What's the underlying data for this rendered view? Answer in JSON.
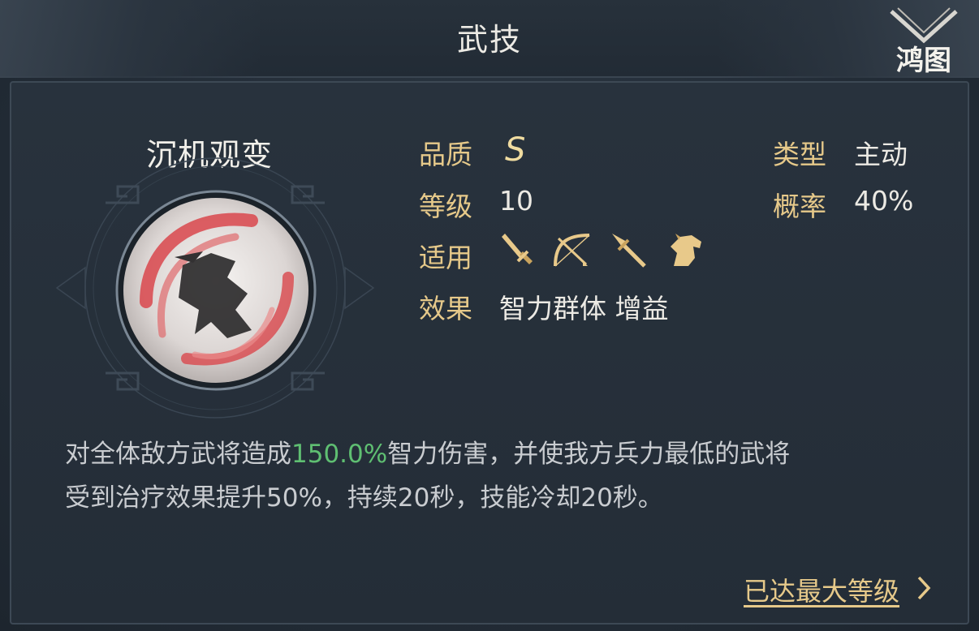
{
  "header": {
    "title": "武技",
    "logo_text": "鸿图"
  },
  "skill": {
    "name": "沉机观变",
    "icon": "swirling-warrior-silhouette-icon",
    "attributes": {
      "quality_label": "品质",
      "quality_value": "S",
      "level_label": "等级",
      "level_value": "10",
      "applicable_label": "适用",
      "applicable_units": [
        "sword-icon",
        "bow-icon",
        "spear-icon",
        "horse-icon"
      ],
      "effect_label": "效果",
      "effect_value": "智力群体 增益",
      "type_label": "类型",
      "type_value": "主动",
      "chance_label": "概率",
      "chance_value": "40%"
    },
    "description": {
      "line1_pre": "对全体敌方武将造成",
      "line1_highlight": "150.0%",
      "line1_post": "智力伤害，并使我方兵力最低的武将",
      "line2": "受到治疗效果提升50%，持续20秒，技能冷却20秒。"
    }
  },
  "footer": {
    "max_level_label": "已达最大等级"
  },
  "colors": {
    "label_gold": "#e6c98a",
    "highlight_green": "#5fbf72",
    "background": "#252f3a"
  }
}
